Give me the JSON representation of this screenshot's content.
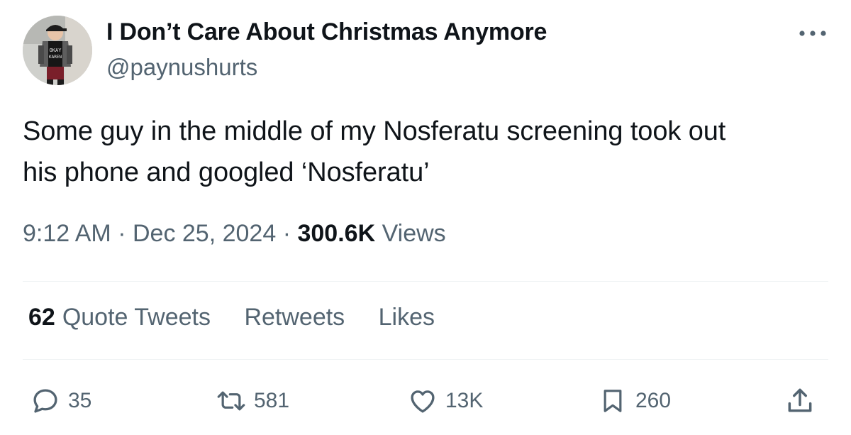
{
  "author": {
    "display_name": "I Don’t Care About Christmas Anymore",
    "handle": "@paynushurts",
    "avatar_shirt_text": [
      "OKAY",
      "KAREN"
    ]
  },
  "tweet": {
    "text": "Some guy in the middle of my Nosferatu screening took out\nhis phone and googled ‘Nosferatu’",
    "time": "9:12 AM",
    "separator": "·",
    "date": "Dec 25, 2024",
    "views_count": "300.6K",
    "views_label": "Views"
  },
  "stats": {
    "quote_tweets_count": "62",
    "quote_tweets_label": "Quote Tweets",
    "retweets_label": "Retweets",
    "likes_label": "Likes"
  },
  "actions": {
    "reply_count": "35",
    "retweet_count": "581",
    "like_count": "13K",
    "bookmark_count": "260"
  },
  "icons": {
    "more": "more-horizontal-icon",
    "reply": "reply-bubble-icon",
    "retweet": "retweet-icon",
    "like": "heart-icon",
    "bookmark": "bookmark-icon",
    "share": "share-icon"
  },
  "colors": {
    "text_primary": "#0f1419",
    "text_secondary": "#536471",
    "divider": "#eff3f4"
  }
}
